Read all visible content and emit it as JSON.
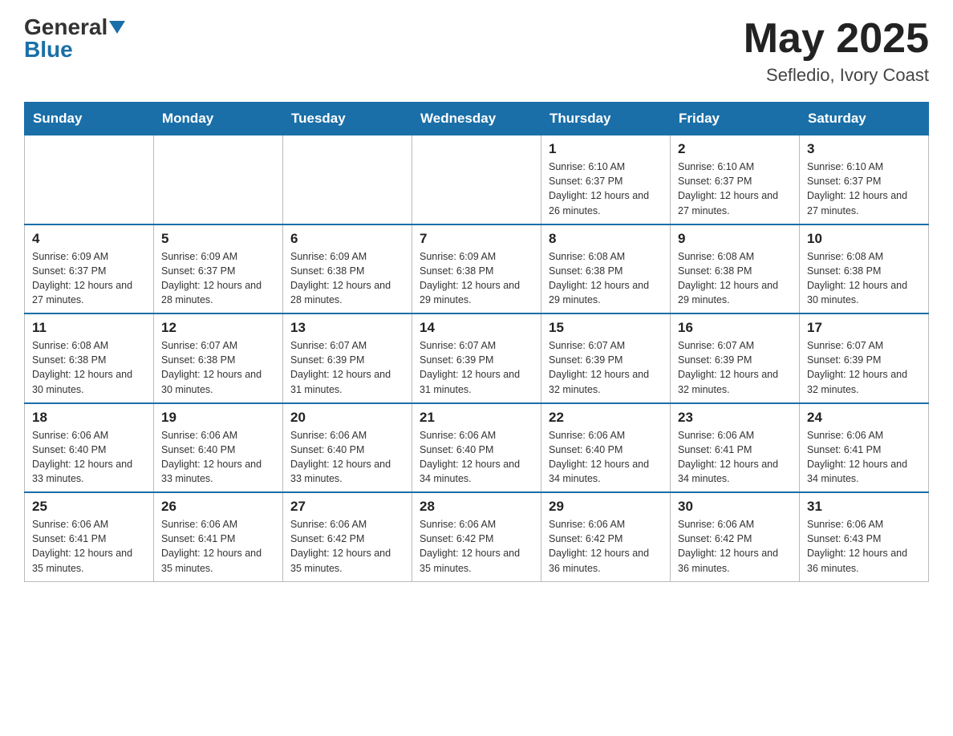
{
  "header": {
    "logo_general": "General",
    "logo_blue": "Blue",
    "month_year": "May 2025",
    "location": "Sefledio, Ivory Coast"
  },
  "weekdays": [
    "Sunday",
    "Monday",
    "Tuesday",
    "Wednesday",
    "Thursday",
    "Friday",
    "Saturday"
  ],
  "weeks": [
    [
      {
        "day": "",
        "info": ""
      },
      {
        "day": "",
        "info": ""
      },
      {
        "day": "",
        "info": ""
      },
      {
        "day": "",
        "info": ""
      },
      {
        "day": "1",
        "info": "Sunrise: 6:10 AM\nSunset: 6:37 PM\nDaylight: 12 hours and 26 minutes."
      },
      {
        "day": "2",
        "info": "Sunrise: 6:10 AM\nSunset: 6:37 PM\nDaylight: 12 hours and 27 minutes."
      },
      {
        "day": "3",
        "info": "Sunrise: 6:10 AM\nSunset: 6:37 PM\nDaylight: 12 hours and 27 minutes."
      }
    ],
    [
      {
        "day": "4",
        "info": "Sunrise: 6:09 AM\nSunset: 6:37 PM\nDaylight: 12 hours and 27 minutes."
      },
      {
        "day": "5",
        "info": "Sunrise: 6:09 AM\nSunset: 6:37 PM\nDaylight: 12 hours and 28 minutes."
      },
      {
        "day": "6",
        "info": "Sunrise: 6:09 AM\nSunset: 6:38 PM\nDaylight: 12 hours and 28 minutes."
      },
      {
        "day": "7",
        "info": "Sunrise: 6:09 AM\nSunset: 6:38 PM\nDaylight: 12 hours and 29 minutes."
      },
      {
        "day": "8",
        "info": "Sunrise: 6:08 AM\nSunset: 6:38 PM\nDaylight: 12 hours and 29 minutes."
      },
      {
        "day": "9",
        "info": "Sunrise: 6:08 AM\nSunset: 6:38 PM\nDaylight: 12 hours and 29 minutes."
      },
      {
        "day": "10",
        "info": "Sunrise: 6:08 AM\nSunset: 6:38 PM\nDaylight: 12 hours and 30 minutes."
      }
    ],
    [
      {
        "day": "11",
        "info": "Sunrise: 6:08 AM\nSunset: 6:38 PM\nDaylight: 12 hours and 30 minutes."
      },
      {
        "day": "12",
        "info": "Sunrise: 6:07 AM\nSunset: 6:38 PM\nDaylight: 12 hours and 30 minutes."
      },
      {
        "day": "13",
        "info": "Sunrise: 6:07 AM\nSunset: 6:39 PM\nDaylight: 12 hours and 31 minutes."
      },
      {
        "day": "14",
        "info": "Sunrise: 6:07 AM\nSunset: 6:39 PM\nDaylight: 12 hours and 31 minutes."
      },
      {
        "day": "15",
        "info": "Sunrise: 6:07 AM\nSunset: 6:39 PM\nDaylight: 12 hours and 32 minutes."
      },
      {
        "day": "16",
        "info": "Sunrise: 6:07 AM\nSunset: 6:39 PM\nDaylight: 12 hours and 32 minutes."
      },
      {
        "day": "17",
        "info": "Sunrise: 6:07 AM\nSunset: 6:39 PM\nDaylight: 12 hours and 32 minutes."
      }
    ],
    [
      {
        "day": "18",
        "info": "Sunrise: 6:06 AM\nSunset: 6:40 PM\nDaylight: 12 hours and 33 minutes."
      },
      {
        "day": "19",
        "info": "Sunrise: 6:06 AM\nSunset: 6:40 PM\nDaylight: 12 hours and 33 minutes."
      },
      {
        "day": "20",
        "info": "Sunrise: 6:06 AM\nSunset: 6:40 PM\nDaylight: 12 hours and 33 minutes."
      },
      {
        "day": "21",
        "info": "Sunrise: 6:06 AM\nSunset: 6:40 PM\nDaylight: 12 hours and 34 minutes."
      },
      {
        "day": "22",
        "info": "Sunrise: 6:06 AM\nSunset: 6:40 PM\nDaylight: 12 hours and 34 minutes."
      },
      {
        "day": "23",
        "info": "Sunrise: 6:06 AM\nSunset: 6:41 PM\nDaylight: 12 hours and 34 minutes."
      },
      {
        "day": "24",
        "info": "Sunrise: 6:06 AM\nSunset: 6:41 PM\nDaylight: 12 hours and 34 minutes."
      }
    ],
    [
      {
        "day": "25",
        "info": "Sunrise: 6:06 AM\nSunset: 6:41 PM\nDaylight: 12 hours and 35 minutes."
      },
      {
        "day": "26",
        "info": "Sunrise: 6:06 AM\nSunset: 6:41 PM\nDaylight: 12 hours and 35 minutes."
      },
      {
        "day": "27",
        "info": "Sunrise: 6:06 AM\nSunset: 6:42 PM\nDaylight: 12 hours and 35 minutes."
      },
      {
        "day": "28",
        "info": "Sunrise: 6:06 AM\nSunset: 6:42 PM\nDaylight: 12 hours and 35 minutes."
      },
      {
        "day": "29",
        "info": "Sunrise: 6:06 AM\nSunset: 6:42 PM\nDaylight: 12 hours and 36 minutes."
      },
      {
        "day": "30",
        "info": "Sunrise: 6:06 AM\nSunset: 6:42 PM\nDaylight: 12 hours and 36 minutes."
      },
      {
        "day": "31",
        "info": "Sunrise: 6:06 AM\nSunset: 6:43 PM\nDaylight: 12 hours and 36 minutes."
      }
    ]
  ]
}
